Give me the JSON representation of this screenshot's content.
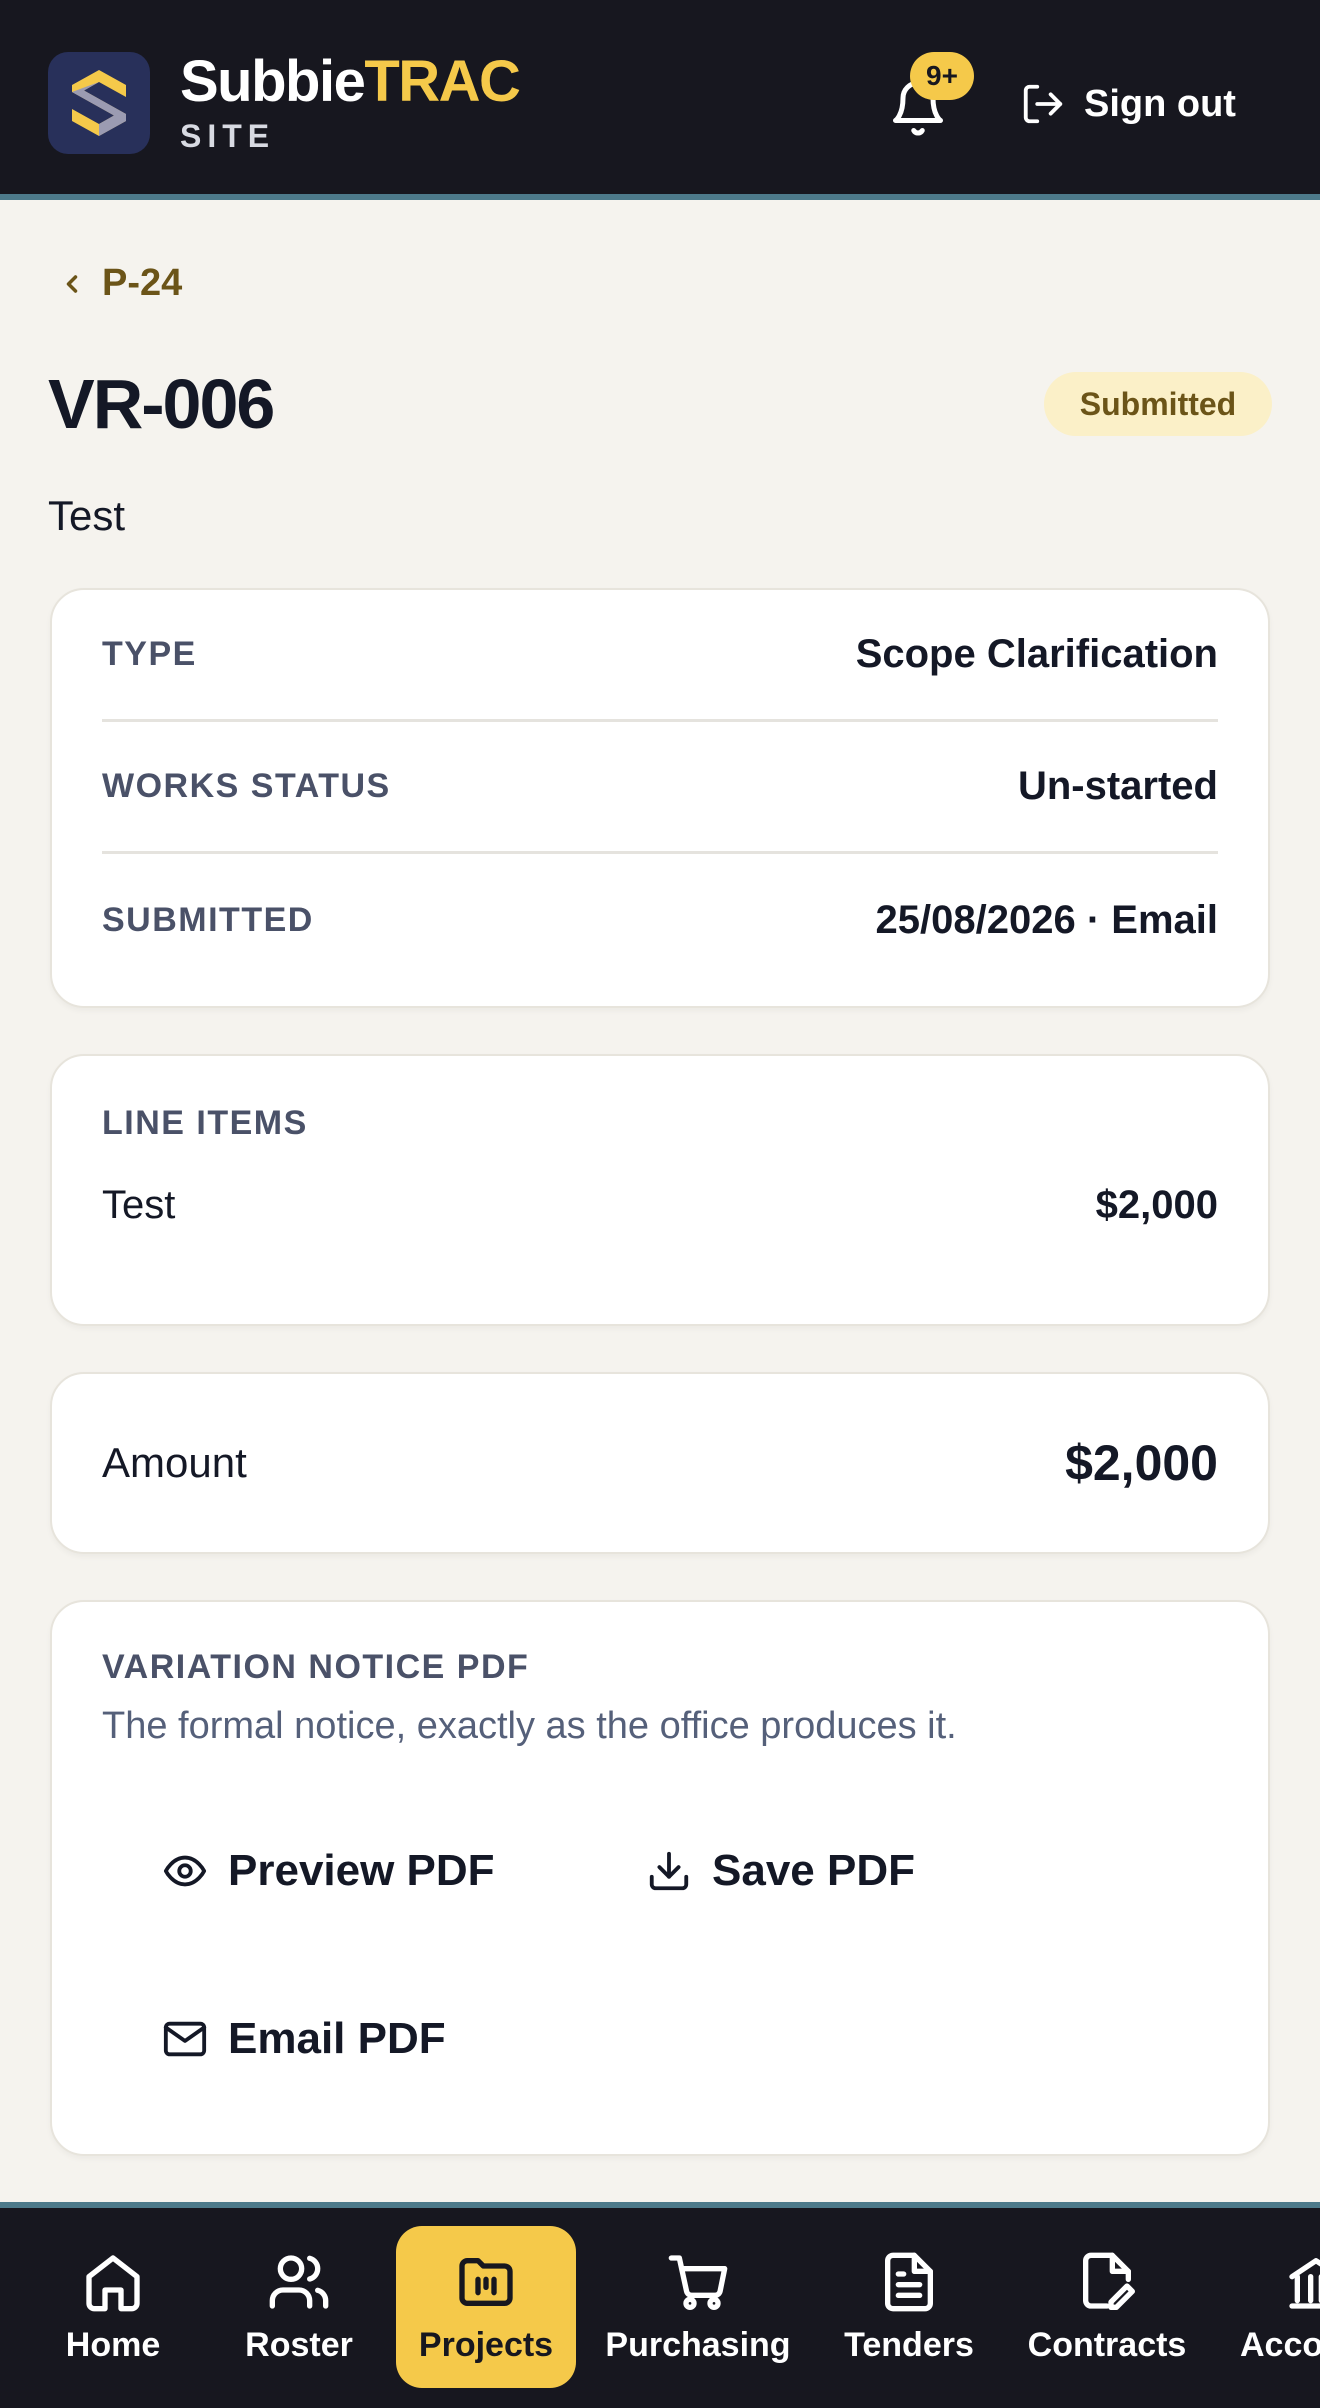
{
  "header": {
    "brand_part1": "Subbie",
    "brand_part2": "TRAC",
    "brand_sub": "SITE",
    "notification_count": "9+",
    "sign_out_label": "Sign out"
  },
  "breadcrumb": {
    "back_label": "P-24"
  },
  "page": {
    "title": "VR-006",
    "status": "Submitted",
    "subtitle": "Test"
  },
  "details": [
    {
      "label": "TYPE",
      "value": "Scope Clarification"
    },
    {
      "label": "WORKS STATUS",
      "value": "Un-started"
    },
    {
      "label": "SUBMITTED",
      "value": "25/08/2026 · Email"
    }
  ],
  "line_items": {
    "heading": "LINE ITEMS",
    "items": [
      {
        "name": "Test",
        "amount": "$2,000"
      }
    ]
  },
  "amount": {
    "label": "Amount",
    "value": "$2,000"
  },
  "pdf": {
    "heading": "VARIATION NOTICE PDF",
    "description": "The formal notice, exactly as the office produces it.",
    "preview_label": "Preview PDF",
    "save_label": "Save PDF",
    "email_label": "Email PDF"
  },
  "nav": {
    "items": [
      {
        "label": "Home",
        "icon": "home-icon"
      },
      {
        "label": "Roster",
        "icon": "users-icon"
      },
      {
        "label": "Projects",
        "icon": "folder-icon",
        "active": true
      },
      {
        "label": "Purchasing",
        "icon": "cart-icon"
      },
      {
        "label": "Tenders",
        "icon": "document-icon"
      },
      {
        "label": "Contracts",
        "icon": "contract-edit-icon"
      },
      {
        "label": "Acco",
        "icon": "bank-icon"
      }
    ]
  },
  "colors": {
    "header_bg": "#17171f",
    "accent_yellow": "#f5c94a",
    "accent_teal": "#4d7a8a",
    "page_bg": "#f5f3ee",
    "brown_text": "#6b5418"
  }
}
